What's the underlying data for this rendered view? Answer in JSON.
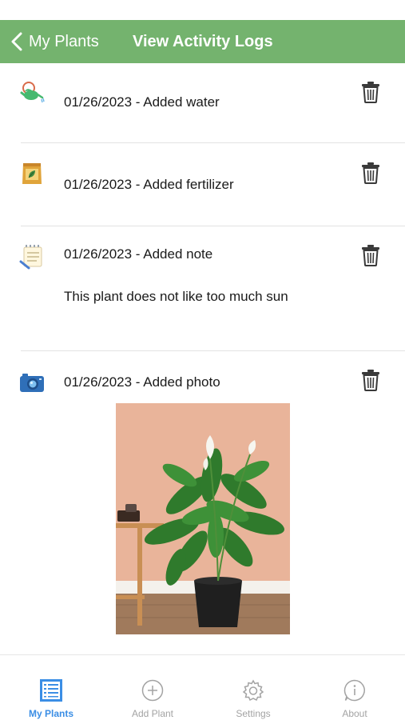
{
  "nav": {
    "back_label": "My Plants",
    "title": "View Activity Logs"
  },
  "entries": [
    {
      "icon": "watering-can-icon",
      "text": "01/26/2023 - Added water"
    },
    {
      "icon": "fertilizer-bag-icon",
      "text": "01/26/2023 - Added fertilizer"
    },
    {
      "icon": "notepad-icon",
      "text": "01/26/2023 - Added note",
      "note": "This plant does not like too much sun"
    },
    {
      "icon": "camera-icon",
      "text": "01/26/2023 - Added photo"
    }
  ],
  "tabs": [
    {
      "label": "My Plants",
      "icon": "list-icon",
      "active": true
    },
    {
      "label": "Add Plant",
      "icon": "plus-circle-icon",
      "active": false
    },
    {
      "label": "Settings",
      "icon": "gear-icon",
      "active": false
    },
    {
      "label": "About",
      "icon": "info-icon",
      "active": false
    }
  ],
  "colors": {
    "navbar": "#74b36e",
    "tab_active": "#3b8ee5",
    "tab_inactive": "#a3a3a3"
  }
}
